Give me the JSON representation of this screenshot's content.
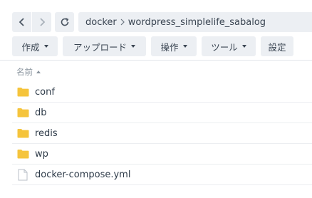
{
  "nav": {
    "back_icon": "chevron-left-icon",
    "forward_icon": "chevron-right-icon",
    "refresh_icon": "refresh-icon",
    "path": [
      "docker",
      "wordpress_simplelife_sabalog"
    ]
  },
  "toolbar": {
    "buttons": [
      {
        "label": "作成",
        "has_dropdown": true
      },
      {
        "label": "アップロード",
        "has_dropdown": true
      },
      {
        "label": "操作",
        "has_dropdown": true
      },
      {
        "label": "ツール",
        "has_dropdown": true
      },
      {
        "label": "設定",
        "has_dropdown": false
      }
    ]
  },
  "list": {
    "column_name": "名前",
    "sort": "ascending",
    "items": [
      {
        "name": "conf",
        "type": "folder"
      },
      {
        "name": "db",
        "type": "folder"
      },
      {
        "name": "redis",
        "type": "folder"
      },
      {
        "name": "wp",
        "type": "folder"
      },
      {
        "name": "docker-compose.yml",
        "type": "file"
      }
    ]
  },
  "colors": {
    "folder": "#f5c43c",
    "button_bg": "#eceff3",
    "text": "#2d3a48"
  }
}
